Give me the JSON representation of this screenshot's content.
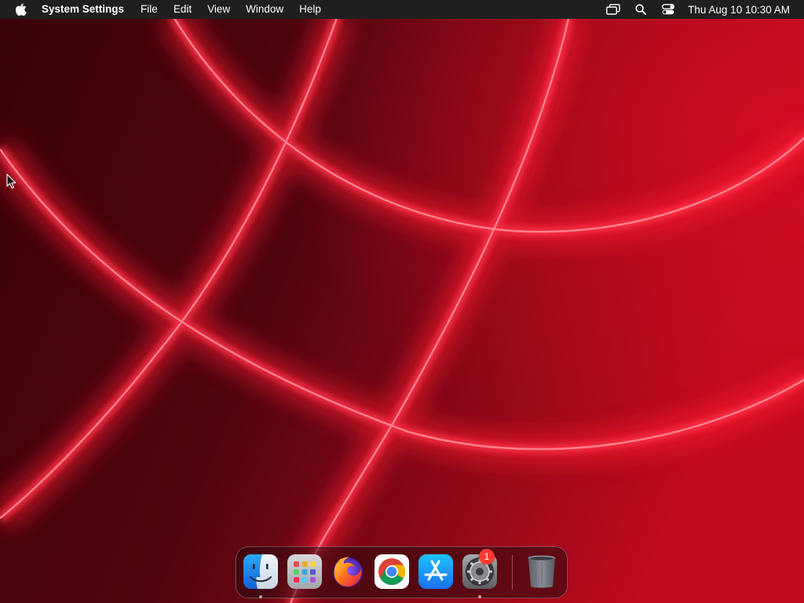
{
  "menubar": {
    "apple_icon": "apple-logo-icon",
    "app_name": "System Settings",
    "menus": [
      "File",
      "Edit",
      "View",
      "Window",
      "Help"
    ],
    "status_icons": [
      "screen-mirroring-icon",
      "spotlight-search-icon",
      "control-center-icon"
    ],
    "clock": "Thu Aug 10  10:30 AM"
  },
  "dock": {
    "apps": [
      {
        "name": "Finder",
        "icon": "finder-icon",
        "running": true
      },
      {
        "name": "Launchpad",
        "icon": "launchpad-icon",
        "running": false
      },
      {
        "name": "Firefox",
        "icon": "firefox-icon",
        "running": false
      },
      {
        "name": "Google Chrome",
        "icon": "chrome-icon",
        "running": false
      },
      {
        "name": "App Store",
        "icon": "app-store-icon",
        "running": false
      },
      {
        "name": "System Settings",
        "icon": "system-settings-icon",
        "running": true,
        "badge": "1"
      },
      {
        "name": "Trash",
        "icon": "trash-icon",
        "running": false
      }
    ]
  },
  "colors": {
    "menubar_bg": "#1f1f1f",
    "wallpaper_base": "#5c0610",
    "wallpaper_glow": "#ff3a4e",
    "badge": "#ff3b30"
  }
}
